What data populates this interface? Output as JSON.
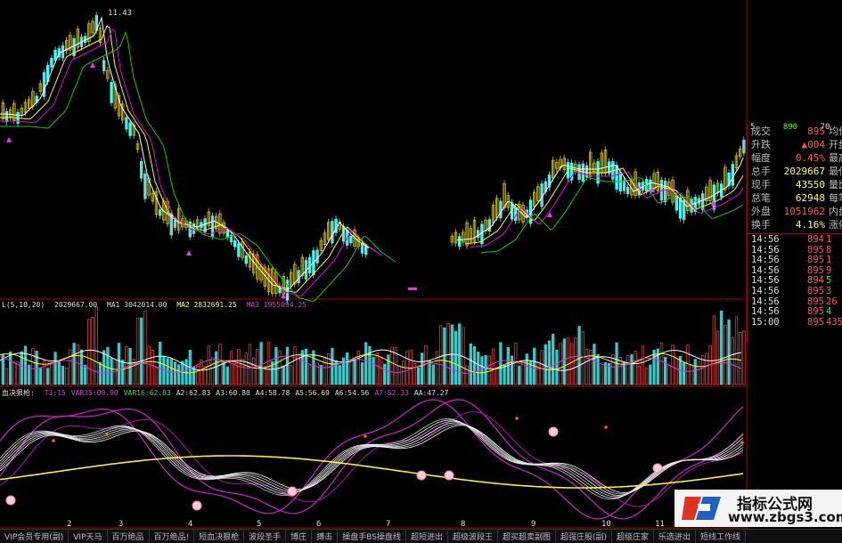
{
  "chart_data": {
    "type": "candlestick",
    "price_high_label": "11.43",
    "volume_legend": {
      "label": "L(5,10,20)",
      "vol": "2029667.00",
      "ma1": "MA1 3042014.00",
      "ma2": "MA2 2832691.25",
      "ma3": "MA3 1955094.25"
    },
    "indicator_legend": {
      "title": "血决狠枪:",
      "items": [
        {
          "text": "T3:15",
          "color": "#d040d0"
        },
        {
          "text": "VAR35:09.90",
          "color": "#d040d0"
        },
        {
          "text": "VAR16:62.83",
          "color": "#33dd33"
        },
        {
          "text": "A2:62.83",
          "color": "#dddddd"
        },
        {
          "text": "A3:60.80",
          "color": "#dddddd"
        },
        {
          "text": "A4:58.78",
          "color": "#dddddd"
        },
        {
          "text": "A5:56.69",
          "color": "#dddddd"
        },
        {
          "text": "A6:54.56",
          "color": "#dddddd"
        },
        {
          "text": "A7:52.33",
          "color": "#d040d0"
        },
        {
          "text": "AA:47.27",
          "color": "#dddddd"
        }
      ]
    },
    "x_ticks": [
      "2",
      "3",
      "4",
      "5",
      "6",
      "7",
      "8",
      "9",
      "10",
      "11"
    ],
    "right_top_values": [
      "5",
      "890",
      "70"
    ]
  },
  "quote": {
    "rows": [
      {
        "label": "成交",
        "value": "895",
        "color": "#ff5555",
        "tail": "均价"
      },
      {
        "label": "升跌",
        "value": "▲004",
        "color": "#ff5555",
        "tail": "开盘"
      },
      {
        "label": "幅度",
        "value": "0.45%",
        "color": "#ff5555",
        "tail": "最高"
      },
      {
        "label": "总手",
        "value": "2029667",
        "color": "#ffff55",
        "tail": "最低"
      },
      {
        "label": "现手",
        "value": "43550",
        "color": "#ffff55",
        "tail": "量比"
      },
      {
        "label": "总笔",
        "value": "62948",
        "color": "#ffff55",
        "tail": "每笔"
      },
      {
        "label": "外盘",
        "value": "1051962",
        "color": "#ff5555",
        "tail": "内盘"
      },
      {
        "label": "换手",
        "value": "4.16%",
        "color": "#ffff55",
        "tail": "涨停"
      }
    ],
    "ticks": [
      {
        "time": "14:56",
        "price": "894",
        "vol": "1",
        "dir": "up"
      },
      {
        "time": "14:56",
        "price": "895",
        "vol": "8",
        "dir": "up"
      },
      {
        "time": "14:56",
        "price": "895",
        "vol": "1",
        "dir": "up"
      },
      {
        "time": "14:56",
        "price": "895",
        "vol": "9",
        "dir": "up"
      },
      {
        "time": "14:56",
        "price": "894",
        "vol": "5",
        "dir": "down"
      },
      {
        "time": "14:56",
        "price": "895",
        "vol": "3",
        "dir": "up"
      },
      {
        "time": "14:56",
        "price": "895",
        "vol": "26",
        "dir": "up"
      },
      {
        "time": "14:56",
        "price": "895",
        "vol": "4",
        "dir": "down"
      },
      {
        "time": "15:00",
        "price": "895",
        "vol": "435",
        "dir": "up"
      }
    ]
  },
  "tabs": [
    "VIP会员专用(副)",
    "VIP天马",
    "百万绝品",
    "百万绝品!",
    "短血决狠枪",
    "波段圣手",
    "博庄",
    "搏击",
    "操盘手BS操盘线",
    "超短进出",
    "超级波段王",
    "超买超卖副图",
    "超强庄股(副)",
    "超级庄家",
    "乐选进出",
    "短线工作线"
  ],
  "watermark": {
    "line1": "指标公式网",
    "line2": "www.zbgs3.com"
  },
  "colors": {
    "up": "#ff4444",
    "down": "#33ffff",
    "candle_yellow": "#d8c000",
    "ma_white": "#ffffff",
    "ma_yellow": "#ffff00",
    "ma_green": "#00cc00",
    "ma_magenta": "#dd00dd"
  }
}
